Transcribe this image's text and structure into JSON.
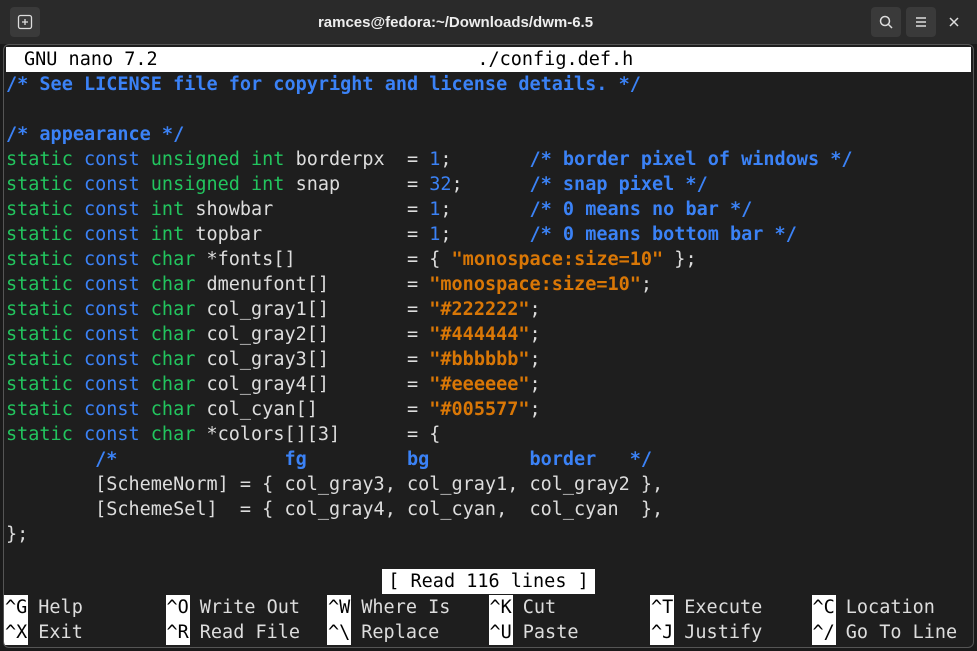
{
  "window": {
    "title": "ramces@fedora:~/Downloads/dwm-6.5"
  },
  "nano": {
    "header_left": "GNU nano 7.2",
    "filename": "./config.def.h",
    "status": "[ Read 116 lines ]",
    "lines": [
      [
        [
          "cmt",
          "/* See LICENSE file for copyright and license details. */"
        ]
      ],
      [],
      [
        [
          "cmt",
          "/* appearance */"
        ]
      ],
      [
        [
          "kw-static",
          "static"
        ],
        [
          "",
          ""
        ],
        [
          "kw-const",
          " const"
        ],
        [
          "kw-type",
          " unsigned int"
        ],
        [
          "",
          " borderpx  = "
        ],
        [
          "num",
          "1"
        ],
        [
          "",
          ";       "
        ],
        [
          "cmt",
          "/* border pixel of windows */"
        ]
      ],
      [
        [
          "kw-static",
          "static"
        ],
        [
          "",
          ""
        ],
        [
          "kw-const",
          " const"
        ],
        [
          "kw-type",
          " unsigned int"
        ],
        [
          "",
          " snap      = "
        ],
        [
          "num",
          "32"
        ],
        [
          "",
          ";      "
        ],
        [
          "cmt",
          "/* snap pixel */"
        ]
      ],
      [
        [
          "kw-static",
          "static"
        ],
        [
          "",
          ""
        ],
        [
          "kw-const",
          " const"
        ],
        [
          "kw-type",
          " int"
        ],
        [
          "",
          " showbar            = "
        ],
        [
          "num",
          "1"
        ],
        [
          "",
          ";       "
        ],
        [
          "cmt",
          "/* 0 means no bar */"
        ]
      ],
      [
        [
          "kw-static",
          "static"
        ],
        [
          "",
          ""
        ],
        [
          "kw-const",
          " const"
        ],
        [
          "kw-type",
          " int"
        ],
        [
          "",
          " topbar             = "
        ],
        [
          "num",
          "1"
        ],
        [
          "",
          ";       "
        ],
        [
          "cmt",
          "/* 0 means bottom bar */"
        ]
      ],
      [
        [
          "kw-static",
          "static"
        ],
        [
          "",
          ""
        ],
        [
          "kw-const",
          " const"
        ],
        [
          "kw-type",
          " char"
        ],
        [
          "",
          " *fonts[]          = { "
        ],
        [
          "str",
          "\"monospace:size=10\""
        ],
        [
          "",
          " };"
        ]
      ],
      [
        [
          "kw-static",
          "static"
        ],
        [
          "",
          ""
        ],
        [
          "kw-const",
          " const"
        ],
        [
          "kw-type",
          " char"
        ],
        [
          "",
          " dmenufont[]       = "
        ],
        [
          "str",
          "\"monospace:size=10\""
        ],
        [
          "",
          ";"
        ]
      ],
      [
        [
          "kw-static",
          "static"
        ],
        [
          "",
          ""
        ],
        [
          "kw-const",
          " const"
        ],
        [
          "kw-type",
          " char"
        ],
        [
          "",
          " col_gray1[]       = "
        ],
        [
          "str",
          "\"#222222\""
        ],
        [
          "",
          ";"
        ]
      ],
      [
        [
          "kw-static",
          "static"
        ],
        [
          "",
          ""
        ],
        [
          "kw-const",
          " const"
        ],
        [
          "kw-type",
          " char"
        ],
        [
          "",
          " col_gray2[]       = "
        ],
        [
          "str",
          "\"#444444\""
        ],
        [
          "",
          ";"
        ]
      ],
      [
        [
          "kw-static",
          "static"
        ],
        [
          "",
          ""
        ],
        [
          "kw-const",
          " const"
        ],
        [
          "kw-type",
          " char"
        ],
        [
          "",
          " col_gray3[]       = "
        ],
        [
          "str",
          "\"#bbbbbb\""
        ],
        [
          "",
          ";"
        ]
      ],
      [
        [
          "kw-static",
          "static"
        ],
        [
          "",
          ""
        ],
        [
          "kw-const",
          " const"
        ],
        [
          "kw-type",
          " char"
        ],
        [
          "",
          " col_gray4[]       = "
        ],
        [
          "str",
          "\"#eeeeee\""
        ],
        [
          "",
          ";"
        ]
      ],
      [
        [
          "kw-static",
          "static"
        ],
        [
          "",
          ""
        ],
        [
          "kw-const",
          " const"
        ],
        [
          "kw-type",
          " char"
        ],
        [
          "",
          " col_cyan[]        = "
        ],
        [
          "str",
          "\"#005577\""
        ],
        [
          "",
          ";"
        ]
      ],
      [
        [
          "kw-static",
          "static"
        ],
        [
          "",
          ""
        ],
        [
          "kw-const",
          " const"
        ],
        [
          "kw-type",
          " char"
        ],
        [
          "",
          " *colors[][3]      = {"
        ]
      ],
      [
        [
          "",
          "        "
        ],
        [
          "cmt",
          "/*               fg         bg         border   */"
        ]
      ],
      [
        [
          "",
          "        [SchemeNorm] = { col_gray3, col_gray1, col_gray2 },"
        ]
      ],
      [
        [
          "",
          "        [SchemeSel]  = { col_gray4, col_cyan,  col_cyan  },"
        ]
      ],
      [
        [
          "",
          "};"
        ]
      ]
    ],
    "shortcuts": [
      {
        "key": "^G",
        "label": "Help"
      },
      {
        "key": "^O",
        "label": "Write Out"
      },
      {
        "key": "^W",
        "label": "Where Is"
      },
      {
        "key": "^K",
        "label": "Cut"
      },
      {
        "key": "^T",
        "label": "Execute"
      },
      {
        "key": "^C",
        "label": "Location"
      },
      {
        "key": "^X",
        "label": "Exit"
      },
      {
        "key": "^R",
        "label": "Read File"
      },
      {
        "key": "^\\",
        "label": "Replace"
      },
      {
        "key": "^U",
        "label": "Paste"
      },
      {
        "key": "^J",
        "label": "Justify"
      },
      {
        "key": "^/",
        "label": "Go To Line"
      }
    ]
  }
}
